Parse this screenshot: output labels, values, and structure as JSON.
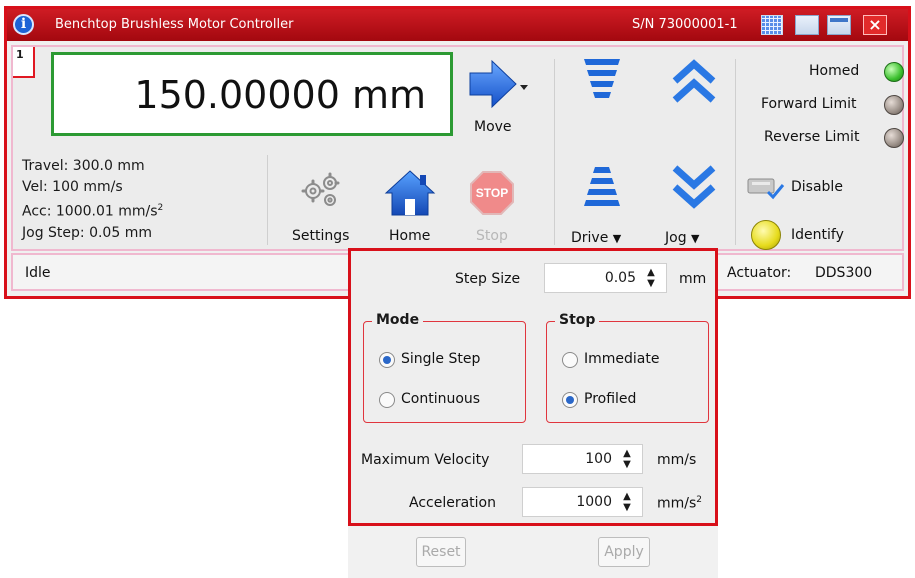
{
  "titlebar": {
    "title": "Benchtop Brushless Motor Controller",
    "serial": "S/N 73000001-1",
    "info_glyph": "i",
    "close_glyph": "×"
  },
  "panel": {
    "channel": "1",
    "position": "150.00000 mm",
    "info": {
      "travel": "Travel: 300.0 mm",
      "vel": "Vel: 100 mm/s",
      "acc_prefix": "Acc: 1000.01 mm/s",
      "acc_sup": "2",
      "jog_step": "Jog Step: 0.05 mm"
    },
    "buttons": {
      "move": "Move",
      "settings": "Settings",
      "home": "Home",
      "stop": "Stop",
      "stop_sign": "STOP",
      "drive": "Drive",
      "jog": "Jog",
      "disable": "Disable",
      "identify": "Identify"
    },
    "indicators": {
      "homed": "Homed",
      "forward_limit": "Forward Limit",
      "reverse_limit": "Reverse Limit"
    },
    "colors": {
      "accent_red": "#d8101a",
      "homed_led": "#3cc02e",
      "limit_led": "#9a8f87",
      "identify_led": "#e6db1c",
      "position_border": "#2c9a33",
      "arrow_blue": "#1e6fe0"
    }
  },
  "statusbar": {
    "state": "Idle",
    "actuator_label": "Actuator:",
    "actuator_value": "DDS300"
  },
  "jog_popup": {
    "step_size_label": "Step Size",
    "step_size_value": "0.05",
    "step_size_unit": "mm",
    "mode_title": "Mode",
    "mode_options": [
      "Single Step",
      "Continuous"
    ],
    "mode_selected": "Single Step",
    "stop_title": "Stop",
    "stop_options": [
      "Immediate",
      "Profiled"
    ],
    "stop_selected": "Profiled",
    "max_velocity_label": "Maximum Velocity",
    "max_velocity_value": "100",
    "max_velocity_unit": "mm/s",
    "acceleration_label": "Acceleration",
    "acceleration_value": "1000",
    "acceleration_unit_base": "mm/s",
    "acceleration_unit_sup": "2",
    "reset": "Reset",
    "apply": "Apply",
    "spin_up": "▲",
    "spin_down": "▼"
  }
}
